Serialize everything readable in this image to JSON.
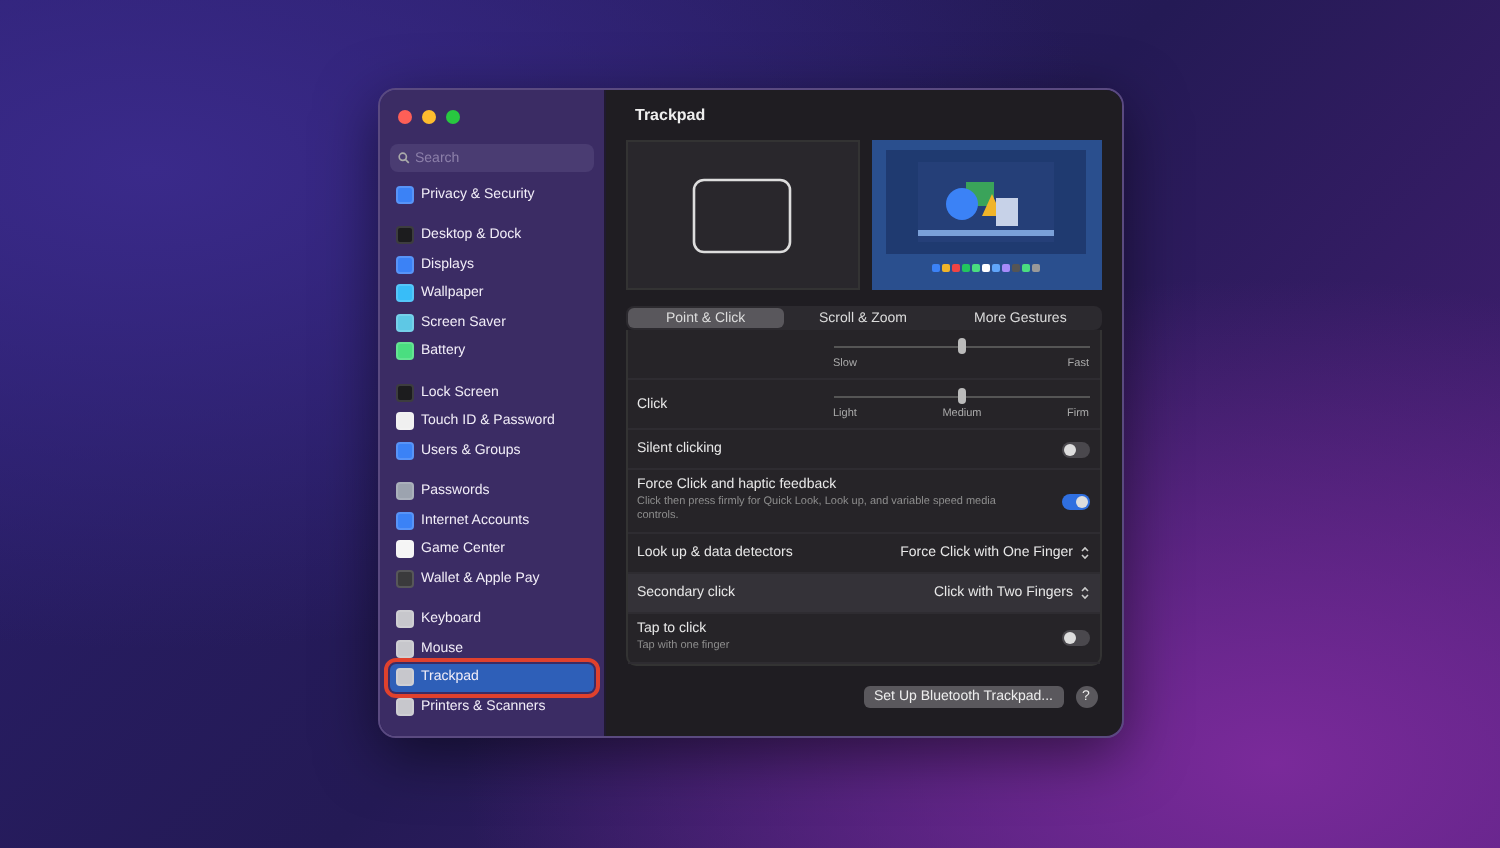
{
  "sidebar": {
    "search": {
      "placeholder": "Search"
    },
    "groups": [
      [
        {
          "label": "Privacy & Security",
          "selected": false,
          "color": "#3b82f6"
        }
      ],
      [
        {
          "label": "Desktop & Dock",
          "selected": false,
          "color": "#1c1c1e"
        },
        {
          "label": "Displays",
          "selected": false,
          "color": "#3b82f6"
        },
        {
          "label": "Wallpaper",
          "selected": false,
          "color": "#38bdf8"
        },
        {
          "label": "Screen Saver",
          "selected": false,
          "color": "#5ec8e5"
        },
        {
          "label": "Battery",
          "selected": false,
          "color": "#4ade80"
        }
      ],
      [
        {
          "label": "Lock Screen",
          "selected": false,
          "color": "#1c1c1e"
        },
        {
          "label": "Touch ID & Password",
          "selected": false,
          "color": "#f0f0f0"
        },
        {
          "label": "Users & Groups",
          "selected": false,
          "color": "#3b82f6"
        }
      ],
      [
        {
          "label": "Passwords",
          "selected": false,
          "color": "#9ca3af"
        },
        {
          "label": "Internet Accounts",
          "selected": false,
          "color": "#3b82f6"
        },
        {
          "label": "Game Center",
          "selected": false,
          "color": "#f5f5f5"
        },
        {
          "label": "Wallet & Apple Pay",
          "selected": false,
          "color": "#3a3a3c"
        }
      ],
      [
        {
          "label": "Keyboard",
          "selected": false,
          "color": "#c7c7cc"
        },
        {
          "label": "Mouse",
          "selected": false,
          "color": "#c7c7cc"
        },
        {
          "label": "Trackpad",
          "selected": true,
          "color": "#c7c7cc"
        },
        {
          "label": "Printers & Scanners",
          "selected": false,
          "color": "#c7c7cc"
        }
      ]
    ]
  },
  "content": {
    "title": "Trackpad",
    "tabs": [
      {
        "label": "Point & Click",
        "selected": true
      },
      {
        "label": "Scroll & Zoom",
        "selected": false
      },
      {
        "label": "More Gestures",
        "selected": false
      }
    ],
    "rows": [
      {
        "kind": "slider",
        "level": 0.5,
        "ticks": [
          "Slow",
          "Fast"
        ],
        "highlighted": false
      },
      {
        "kind": "slider",
        "label": "Click",
        "level": 0.5,
        "ticks": [
          "Light",
          "Medium",
          "Firm"
        ],
        "highlighted": false
      },
      {
        "kind": "toggle",
        "label": "Silent clicking",
        "on": false,
        "highlighted": false
      },
      {
        "kind": "toggle",
        "label": "Force Click and haptic feedback",
        "description": "Click then press firmly for Quick Look, Look up, and variable speed media controls.",
        "on": true,
        "highlighted": false
      },
      {
        "kind": "select",
        "label": "Look up & data detectors",
        "value": "Force Click with One Finger",
        "highlighted": false
      },
      {
        "kind": "select",
        "label": "Secondary click",
        "value": "Click with Two Fingers",
        "highlighted": true
      },
      {
        "kind": "toggle",
        "label": "Tap to click",
        "description": "Tap with one finger",
        "on": false,
        "highlighted": false
      }
    ],
    "setup_button": "Set Up Bluetooth Trackpad...",
    "help_button": "?"
  }
}
